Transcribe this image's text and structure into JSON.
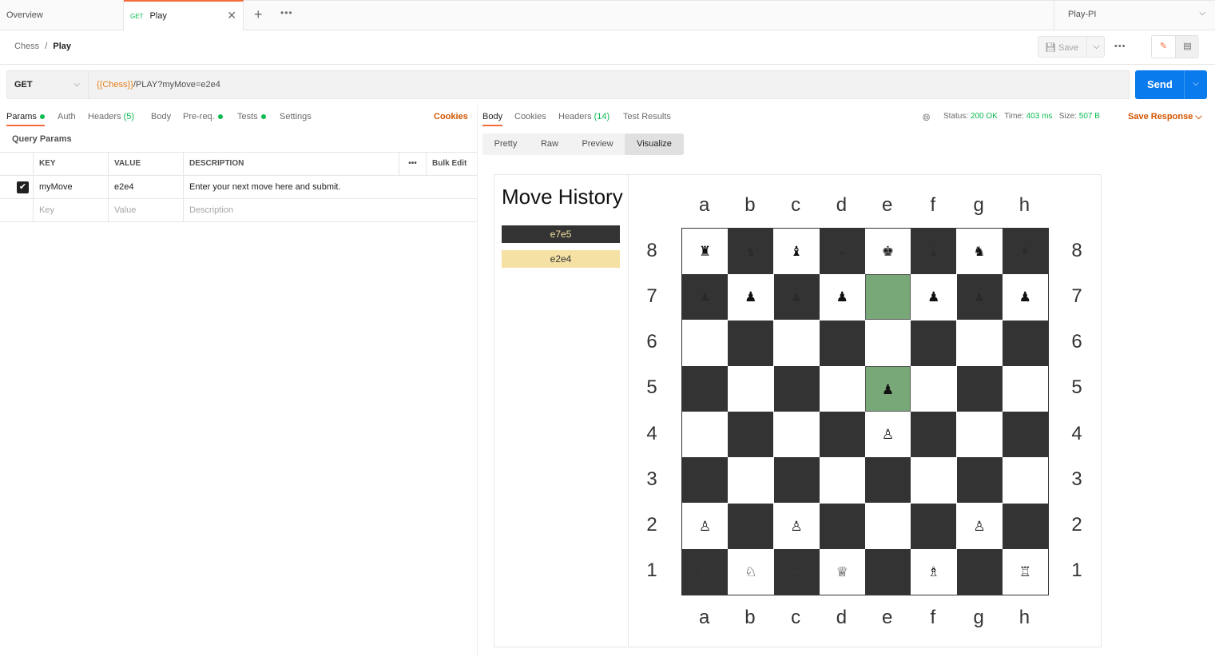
{
  "tabs": {
    "overview": "Overview",
    "play_method": "GET",
    "play_label": "Play",
    "env": "Play-PI"
  },
  "breadcrumb": {
    "collection": "Chess",
    "sep": "/",
    "request": "Play"
  },
  "toolbar": {
    "save": "Save"
  },
  "request": {
    "method": "GET",
    "url_var": "{{Chess}}",
    "url_rest": "/PLAY?myMove=e2e4",
    "send": "Send"
  },
  "req_tabs": {
    "params": "Params",
    "auth": "Auth",
    "headers": "Headers",
    "headers_count": "(5)",
    "body": "Body",
    "prereq": "Pre-req.",
    "tests": "Tests",
    "settings": "Settings",
    "cookies": "Cookies"
  },
  "query_params": {
    "title": "Query Params",
    "headers": {
      "key": "KEY",
      "value": "VALUE",
      "description": "DESCRIPTION",
      "bulk_edit": "Bulk Edit"
    },
    "rows": [
      {
        "checked": true,
        "key": "myMove",
        "value": "e2e4",
        "description": "Enter your next move here and submit."
      }
    ],
    "placeholders": {
      "key": "Key",
      "value": "Value",
      "description": "Description"
    }
  },
  "response": {
    "tabs": {
      "body": "Body",
      "cookies": "Cookies",
      "headers": "Headers",
      "headers_count": "(14)",
      "tests": "Test Results"
    },
    "status_label": "Status:",
    "status": "200 OK",
    "time_label": "Time:",
    "time": "403 ms",
    "size_label": "Size:",
    "size": "507 B",
    "save_response": "Save Response",
    "view_tabs": [
      "Pretty",
      "Raw",
      "Preview",
      "Visualize"
    ],
    "active_view": "Visualize"
  },
  "visualizer": {
    "history_title": "Move History",
    "moves": [
      "e7e5",
      "e2e4"
    ],
    "files": [
      "a",
      "b",
      "c",
      "d",
      "e",
      "f",
      "g",
      "h"
    ],
    "ranks": [
      "8",
      "7",
      "6",
      "5",
      "4",
      "3",
      "2",
      "1"
    ],
    "board": [
      [
        "♜",
        "♞",
        "♝",
        "♛",
        "♚",
        "♝",
        "♞",
        "♜"
      ],
      [
        "♟",
        "♟",
        "♟",
        "♟",
        "",
        "♟",
        "♟",
        "♟"
      ],
      [
        "",
        "",
        "",
        "",
        "",
        "",
        "",
        ""
      ],
      [
        "",
        "",
        "",
        "",
        "♟",
        "",
        "",
        ""
      ],
      [
        "",
        "",
        "",
        "",
        "♙",
        "",
        "",
        ""
      ],
      [
        "",
        "",
        "",
        "",
        "",
        "",
        "",
        ""
      ],
      [
        "♙",
        "♙",
        "♙",
        "♙",
        "",
        "♙",
        "♙",
        "♙"
      ],
      [
        "♖",
        "♘",
        "♗",
        "♕",
        "♔",
        "♗",
        "♘",
        "♖"
      ]
    ],
    "highlight": [
      "e7",
      "e5"
    ],
    "colors": {
      "dark": "#333333",
      "light": "#ffffff",
      "highlight": "#78a878",
      "history_light": "#f5e1a4"
    }
  }
}
